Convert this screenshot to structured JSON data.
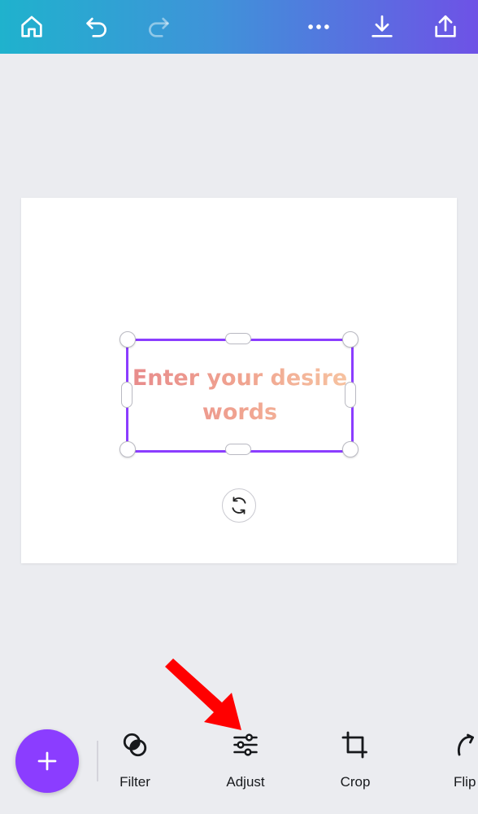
{
  "topbar": {
    "icons": [
      "home-icon",
      "undo-icon",
      "redo-icon",
      "more-icon",
      "download-icon",
      "share-icon"
    ],
    "gradient": [
      "#1fb2cd",
      "#3f93d9",
      "#6e52e6"
    ]
  },
  "canvas": {
    "text_line1": "Enter your desire",
    "text_line2": "words",
    "text_gradient": [
      "#e88c8c",
      "#f0a390",
      "#f6c2a0"
    ],
    "selection_color": "#8b3dff"
  },
  "toolbar": {
    "add_icon": "plus-icon",
    "tools": [
      {
        "label": "Filter",
        "icon": "filter-icon"
      },
      {
        "label": "Adjust",
        "icon": "sliders-icon"
      },
      {
        "label": "Crop",
        "icon": "crop-icon"
      },
      {
        "label": "Flip",
        "icon": "flip-icon"
      }
    ]
  },
  "annotation": {
    "icon": "red-arrow-icon",
    "color": "#ff0000"
  }
}
